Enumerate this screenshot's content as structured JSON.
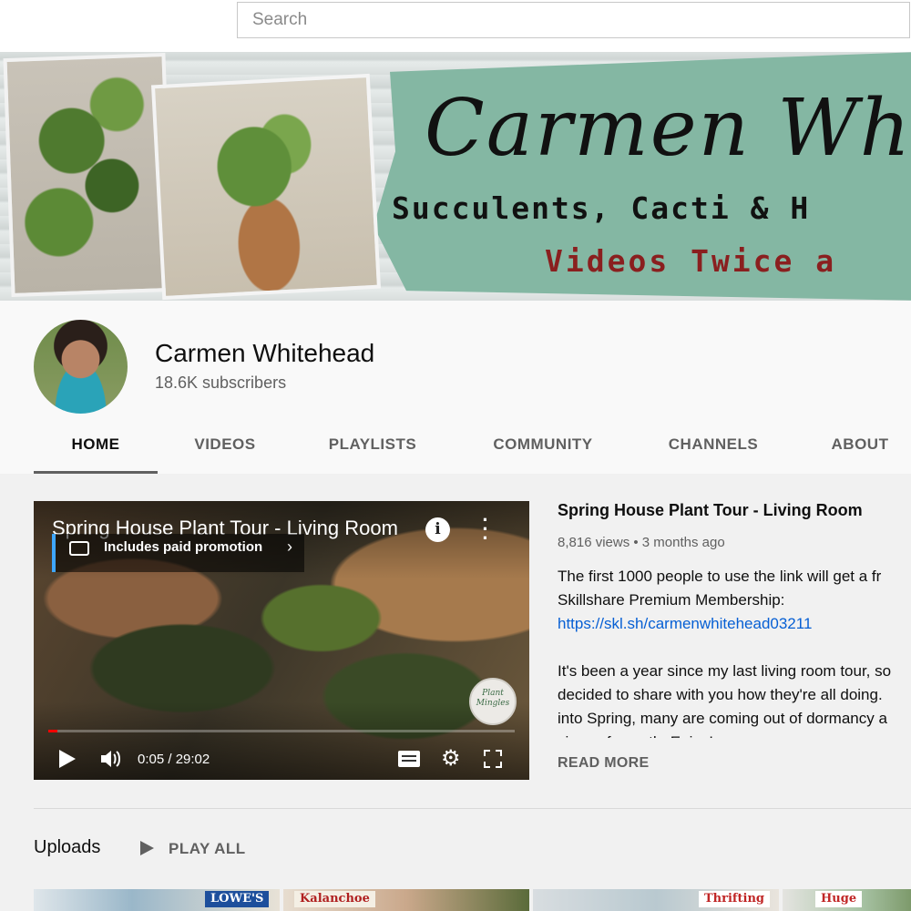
{
  "search": {
    "placeholder": "Search"
  },
  "banner": {
    "title": "Carmen Whit",
    "subtitle": "Succulents, Cacti & H",
    "tagline": "Videos Twice a"
  },
  "channel": {
    "name": "Carmen Whitehead",
    "subscribers": "18.6K subscribers"
  },
  "tabs": [
    {
      "label": "HOME",
      "active": true
    },
    {
      "label": "VIDEOS"
    },
    {
      "label": "PLAYLISTS"
    },
    {
      "label": "COMMUNITY"
    },
    {
      "label": "CHANNELS"
    },
    {
      "label": "ABOUT"
    }
  ],
  "player": {
    "title": "Spring House Plant Tour - Living Room",
    "promo": "Includes paid promotion",
    "time": "0:05 / 29:02",
    "progress": 0.003,
    "badge": "Plant Mingles",
    "icons": [
      "info-icon",
      "more-vert-icon",
      "promo-icon",
      "chevron-right-icon",
      "play-icon",
      "volume-icon",
      "captions-icon",
      "gear-icon",
      "fullscreen-icon"
    ]
  },
  "featured": {
    "title": "Spring House Plant Tour - Living Room",
    "meta": "8,816 views • 3 months ago",
    "desc_lines": [
      "The first 1000 people to use the link will get a fr",
      "Skillshare Premium Membership:"
    ],
    "link": "https://skl.sh/carmenwhitehead03211",
    "desc_lines2": [
      "It's been a year since my last living room tour, so",
      "decided to share with you how they're all doing.",
      "into Spring, many are coming out of dormancy a",
      "signs of growth. Enjoy!"
    ],
    "read_more": "READ MORE"
  },
  "uploads": {
    "title": "Uploads",
    "play_all": "PLAY ALL",
    "thumb_tags": [
      "LOWE'S",
      "Kalanchoe",
      "Thrifting",
      "Huge"
    ]
  },
  "colors": {
    "link": "#065fd4",
    "progress": "#ff0000",
    "banner_teal": "#84b7a3",
    "banner_tag": "#8a1f1f"
  }
}
